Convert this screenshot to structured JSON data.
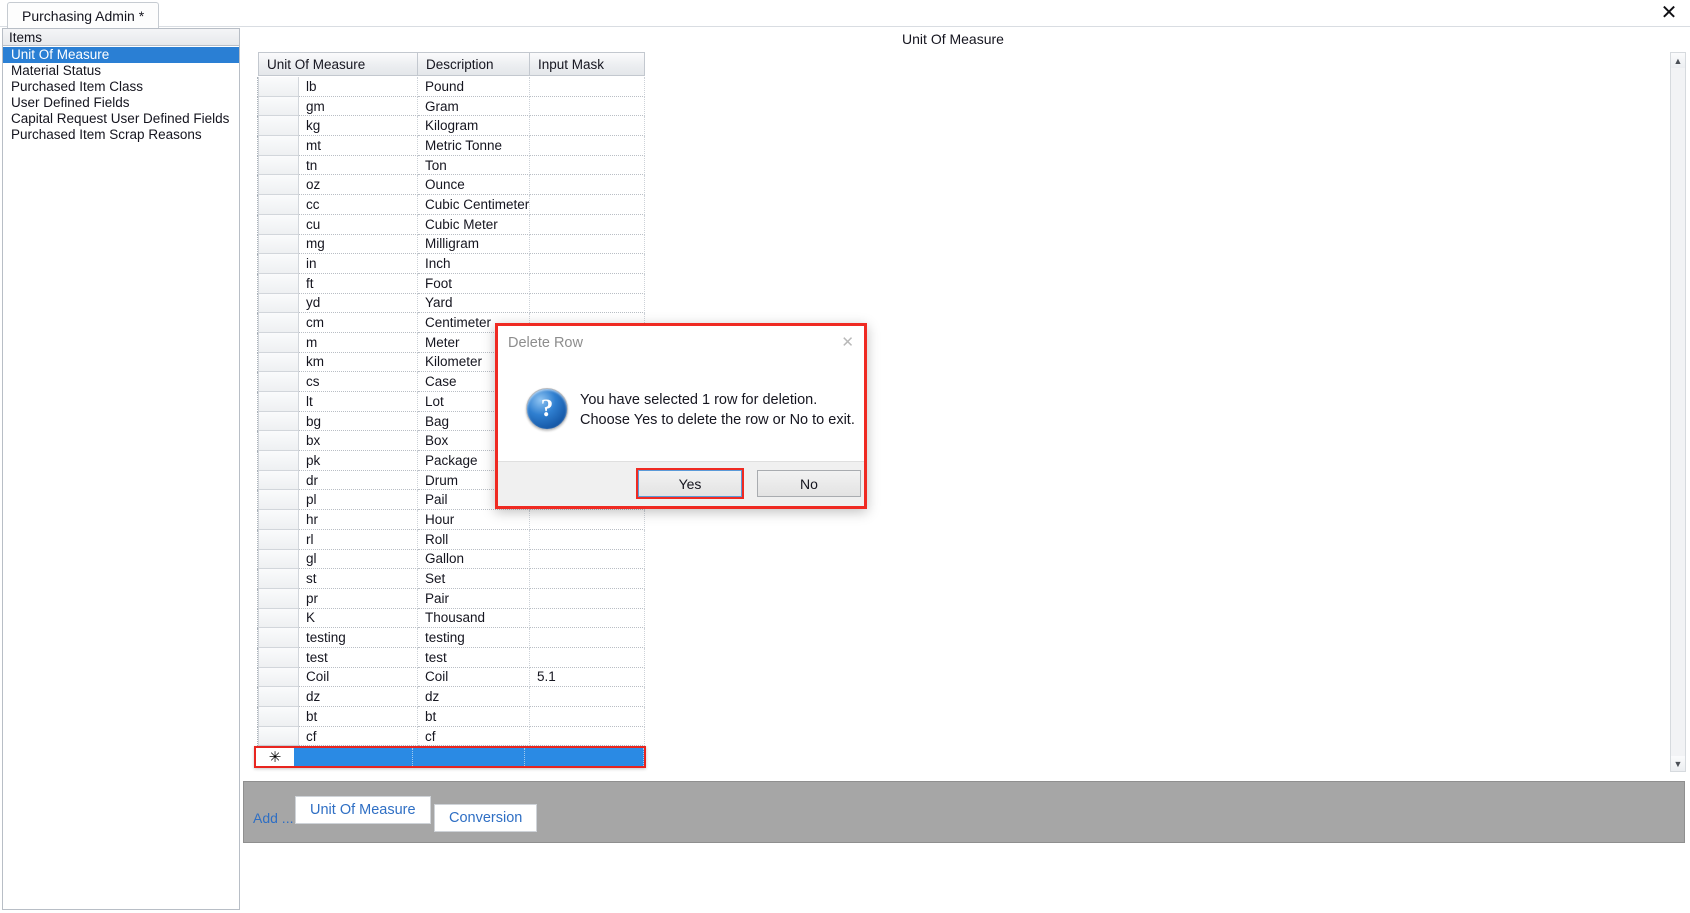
{
  "window": {
    "tab_label": "Purchasing Admin *",
    "close_icon": "close-icon",
    "close_glyph": "✕"
  },
  "sidebar": {
    "header": "Items",
    "items": [
      {
        "label": "Unit Of Measure",
        "selected": true
      },
      {
        "label": "Material Status",
        "selected": false
      },
      {
        "label": "Purchased Item Class",
        "selected": false
      },
      {
        "label": "User Defined Fields",
        "selected": false
      },
      {
        "label": "Capital Request User Defined Fields",
        "selected": false
      },
      {
        "label": "Purchased Item Scrap Reasons",
        "selected": false
      }
    ]
  },
  "main": {
    "title": "Unit Of Measure",
    "grid": {
      "columns": [
        "Unit Of Measure",
        "Description",
        "Input Mask"
      ],
      "rows": [
        {
          "uom": "lb",
          "description": "Pound",
          "input_mask": ""
        },
        {
          "uom": "gm",
          "description": "Gram",
          "input_mask": ""
        },
        {
          "uom": "kg",
          "description": "Kilogram",
          "input_mask": ""
        },
        {
          "uom": "mt",
          "description": "Metric Tonne",
          "input_mask": ""
        },
        {
          "uom": "tn",
          "description": "Ton",
          "input_mask": ""
        },
        {
          "uom": "oz",
          "description": "Ounce",
          "input_mask": ""
        },
        {
          "uom": "cc",
          "description": "Cubic Centimeter",
          "input_mask": ""
        },
        {
          "uom": "cu",
          "description": "Cubic Meter",
          "input_mask": ""
        },
        {
          "uom": "mg",
          "description": "Milligram",
          "input_mask": ""
        },
        {
          "uom": "in",
          "description": "Inch",
          "input_mask": ""
        },
        {
          "uom": "ft",
          "description": "Foot",
          "input_mask": ""
        },
        {
          "uom": "yd",
          "description": "Yard",
          "input_mask": ""
        },
        {
          "uom": "cm",
          "description": "Centimeter",
          "input_mask": ""
        },
        {
          "uom": "m",
          "description": "Meter",
          "input_mask": ""
        },
        {
          "uom": "km",
          "description": "Kilometer",
          "input_mask": ""
        },
        {
          "uom": "cs",
          "description": "Case",
          "input_mask": ""
        },
        {
          "uom": "lt",
          "description": "Lot",
          "input_mask": ""
        },
        {
          "uom": "bg",
          "description": "Bag",
          "input_mask": ""
        },
        {
          "uom": "bx",
          "description": "Box",
          "input_mask": ""
        },
        {
          "uom": "pk",
          "description": "Package",
          "input_mask": ""
        },
        {
          "uom": "dr",
          "description": "Drum",
          "input_mask": ""
        },
        {
          "uom": "pl",
          "description": "Pail",
          "input_mask": ""
        },
        {
          "uom": "hr",
          "description": "Hour",
          "input_mask": ""
        },
        {
          "uom": "rl",
          "description": "Roll",
          "input_mask": ""
        },
        {
          "uom": "gl",
          "description": "Gallon",
          "input_mask": ""
        },
        {
          "uom": "st",
          "description": "Set",
          "input_mask": ""
        },
        {
          "uom": "pr",
          "description": "Pair",
          "input_mask": ""
        },
        {
          "uom": "K",
          "description": "Thousand",
          "input_mask": ""
        },
        {
          "uom": "testing",
          "description": "testing",
          "input_mask": ""
        },
        {
          "uom": "test",
          "description": "test",
          "input_mask": ""
        },
        {
          "uom": "Coil",
          "description": "Coil",
          "input_mask": "5.1"
        },
        {
          "uom": "dz",
          "description": "dz",
          "input_mask": ""
        },
        {
          "uom": "bt",
          "description": "bt",
          "input_mask": ""
        },
        {
          "uom": "cf",
          "description": "cf",
          "input_mask": ""
        }
      ],
      "new_row": {
        "uom": "",
        "description": "",
        "input_mask": "",
        "cursor_glyph": "✳"
      }
    },
    "scrollbar": {
      "up_glyph": "▲",
      "down_glyph": "▼"
    }
  },
  "bottom_toolbar": {
    "add_label": "Add ...",
    "unit_of_measure_label": "Unit Of Measure",
    "conversion_label": "Conversion"
  },
  "dialog": {
    "title": "Delete Row",
    "close_glyph": "✕",
    "icon_glyph": "?",
    "message_line1": "You have selected 1 row for deletion.",
    "message_line2": "Choose Yes to delete the row or No to exit.",
    "yes_label": "Yes",
    "no_label": "No"
  },
  "colors": {
    "selection_blue": "#2a7fd4",
    "new_row_blue": "#2a8ae4",
    "highlight_red": "#ef2a22",
    "toolbar_gray": "#a6a6a6",
    "link_blue": "#2f6fc4"
  }
}
